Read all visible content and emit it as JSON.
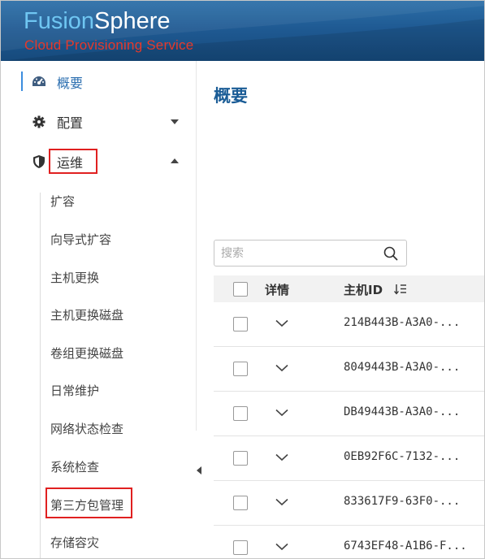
{
  "header": {
    "brand_part1": "Fusion",
    "brand_part2": "Sphere",
    "subtitle": "Cloud Provisioning Service"
  },
  "sidebar": {
    "items": [
      {
        "label": "概要",
        "icon": "dashboard-icon",
        "active": true
      },
      {
        "label": "配置",
        "icon": "gear-icon",
        "expanded": false
      },
      {
        "label": "运维",
        "icon": "shield-icon",
        "expanded": true,
        "highlighted": true
      }
    ],
    "sub_items": [
      {
        "label": "扩容"
      },
      {
        "label": "向导式扩容"
      },
      {
        "label": "主机更换"
      },
      {
        "label": "主机更换磁盘"
      },
      {
        "label": "卷组更换磁盘"
      },
      {
        "label": "日常维护"
      },
      {
        "label": "网络状态检查"
      },
      {
        "label": "系统检查"
      },
      {
        "label": "第三方包管理",
        "highlighted": true
      },
      {
        "label": "存储容灾"
      }
    ]
  },
  "main": {
    "title": "概要",
    "search": {
      "placeholder": "搜索",
      "value": ""
    },
    "table": {
      "columns": [
        "详情",
        "主机ID"
      ],
      "rows": [
        {
          "host_id": "214B443B-A3A0-..."
        },
        {
          "host_id": "8049443B-A3A0-..."
        },
        {
          "host_id": "DB49443B-A3A0-..."
        },
        {
          "host_id": "0EB92F6C-7132-..."
        },
        {
          "host_id": "833617F9-63F0-..."
        },
        {
          "host_id": "6743EF48-A1B6-F..."
        }
      ]
    }
  },
  "colors": {
    "header_bg": "#1f5a93",
    "brand_light": "#6fc6f2",
    "subtitle_red": "#e6392a",
    "title_blue": "#1a5c96",
    "highlight_red": "#e02020",
    "active_bar": "#3c8dde"
  }
}
